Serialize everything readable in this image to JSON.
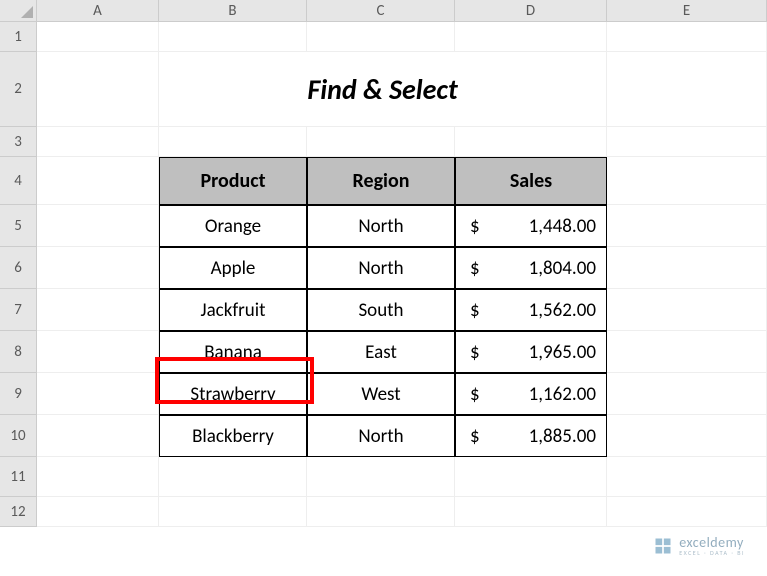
{
  "columns": [
    "A",
    "B",
    "C",
    "D",
    "E"
  ],
  "rows": [
    "1",
    "2",
    "3",
    "4",
    "5",
    "6",
    "7",
    "8",
    "9",
    "10",
    "11",
    "12"
  ],
  "title": "Find & Select",
  "table": {
    "headers": [
      "Product",
      "Region",
      "Sales"
    ],
    "data": [
      {
        "product": "Orange",
        "region": "North",
        "currency": "$",
        "sales": "1,448.00"
      },
      {
        "product": "Apple",
        "region": "North",
        "currency": "$",
        "sales": "1,804.00"
      },
      {
        "product": "Jackfruit",
        "region": "South",
        "currency": "$",
        "sales": "1,562.00"
      },
      {
        "product": "Banana",
        "region": "East",
        "currency": "$",
        "sales": "1,965.00"
      },
      {
        "product": "Strawberry",
        "region": "West",
        "currency": "$",
        "sales": "1,162.00"
      },
      {
        "product": "Blackberry",
        "region": "North",
        "currency": "$",
        "sales": "1,885.00"
      }
    ]
  },
  "highlighted_cell": {
    "row": 8,
    "col": "B",
    "value": "Banana"
  },
  "watermark": {
    "main": "exceldemy",
    "sub": "EXCEL · DATA · BI"
  }
}
